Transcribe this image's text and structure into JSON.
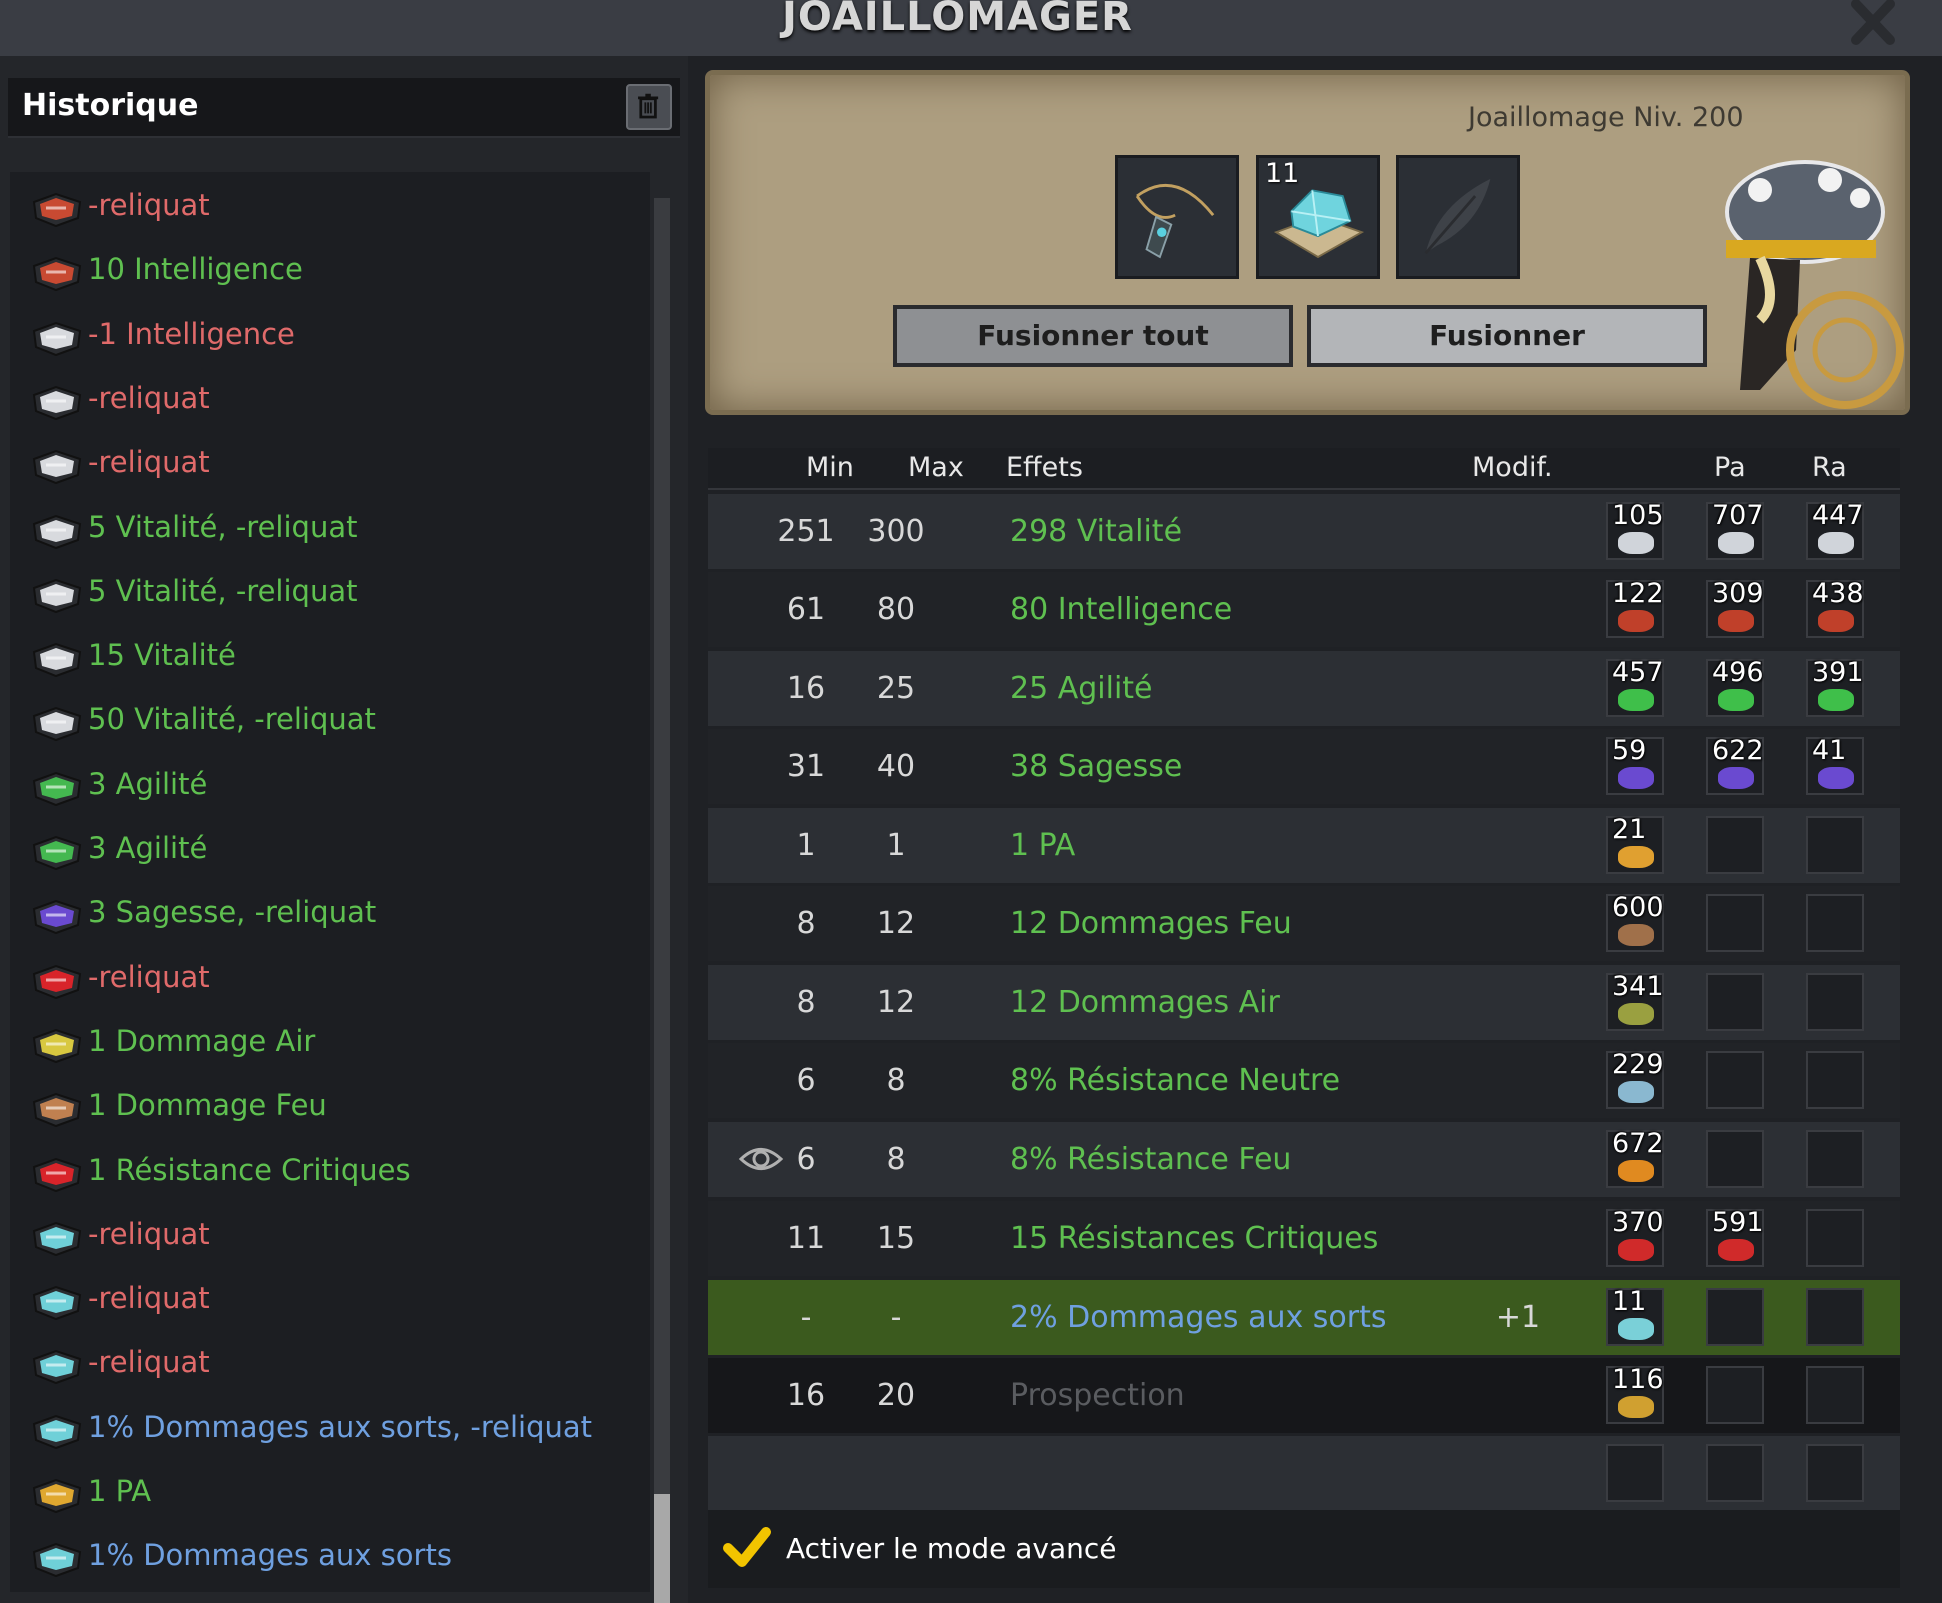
{
  "window": {
    "title": "JOAILLOMAGER"
  },
  "history": {
    "title": "Historique",
    "items": [
      {
        "label": "-reliquat",
        "tone": "red",
        "icon": "red-rune-icon"
      },
      {
        "label": "10 Intelligence",
        "tone": "green",
        "icon": "red-rune-icon"
      },
      {
        "label": "-1 Intelligence",
        "tone": "red",
        "icon": "white-rune-icon"
      },
      {
        "label": "-reliquat",
        "tone": "red",
        "icon": "white-rune-icon"
      },
      {
        "label": "-reliquat",
        "tone": "red",
        "icon": "white-rune-icon"
      },
      {
        "label": "5 Vitalité, -reliquat",
        "tone": "green",
        "icon": "white-rune-icon"
      },
      {
        "label": "5 Vitalité, -reliquat",
        "tone": "green",
        "icon": "white-rune-icon"
      },
      {
        "label": "15 Vitalité",
        "tone": "green",
        "icon": "white-rune-icon"
      },
      {
        "label": "50 Vitalité, -reliquat",
        "tone": "green",
        "icon": "white-rune-icon"
      },
      {
        "label": "3 Agilité",
        "tone": "green",
        "icon": "green-rune-icon"
      },
      {
        "label": "3 Agilité",
        "tone": "green",
        "icon": "green-rune-icon"
      },
      {
        "label": "3 Sagesse, -reliquat",
        "tone": "green",
        "icon": "purple-rune-icon"
      },
      {
        "label": "-reliquat",
        "tone": "red",
        "icon": "red-crystal-icon"
      },
      {
        "label": "1 Dommage Air",
        "tone": "green",
        "icon": "air-rune-icon"
      },
      {
        "label": "1 Dommage Feu",
        "tone": "green",
        "icon": "fire-rune-icon"
      },
      {
        "label": "1 Résistance Critiques",
        "tone": "green",
        "icon": "red-crystal-icon"
      },
      {
        "label": "-reliquat",
        "tone": "red",
        "icon": "cyan-crystal-icon"
      },
      {
        "label": "-reliquat",
        "tone": "red",
        "icon": "cyan-crystal-icon"
      },
      {
        "label": "-reliquat",
        "tone": "red",
        "icon": "cyan-crystal-icon"
      },
      {
        "label": "1% Dommages aux sorts, -reliquat",
        "tone": "blue",
        "icon": "cyan-crystal-icon"
      },
      {
        "label": "1 PA",
        "tone": "green",
        "icon": "gold-rune-icon"
      },
      {
        "label": "1% Dommages aux sorts",
        "tone": "blue",
        "icon": "cyan-crystal-icon"
      }
    ]
  },
  "workshop": {
    "profession_level": "Joaillomage Niv. 200",
    "rune_count": "11",
    "fuse_all_label": "Fusionner tout",
    "fuse_label": "Fusionner"
  },
  "table": {
    "headers": {
      "min": "Min",
      "max": "Max",
      "effects": "Effets",
      "modif": "Modif.",
      "pa": "Pa",
      "ra": "Ra"
    },
    "rows": [
      {
        "min": "251",
        "max": "300",
        "effect": "298 Vitalité",
        "modif": "",
        "runes": [
          "105",
          "707",
          "447"
        ],
        "gem": "#d0d4da"
      },
      {
        "min": "61",
        "max": "80",
        "effect": "80 Intelligence",
        "modif": "",
        "runes": [
          "122",
          "309",
          "438"
        ],
        "gem": "#c0402a"
      },
      {
        "min": "16",
        "max": "25",
        "effect": "25 Agilité",
        "modif": "",
        "runes": [
          "457",
          "496",
          "391"
        ],
        "gem": "#3fbf4a"
      },
      {
        "min": "31",
        "max": "40",
        "effect": "38 Sagesse",
        "modif": "",
        "runes": [
          "59",
          "622",
          "41"
        ],
        "gem": "#6a4ad0"
      },
      {
        "min": "1",
        "max": "1",
        "effect": "1 PA",
        "modif": "",
        "runes": [
          "21",
          "",
          ""
        ],
        "gem": "#e0a030"
      },
      {
        "min": "8",
        "max": "12",
        "effect": "12 Dommages Feu",
        "modif": "",
        "runes": [
          "600",
          "",
          ""
        ],
        "gem": "#a0704a"
      },
      {
        "min": "8",
        "max": "12",
        "effect": "12 Dommages Air",
        "modif": "",
        "runes": [
          "341",
          "",
          ""
        ],
        "gem": "#9aa040"
      },
      {
        "min": "6",
        "max": "8",
        "effect": "8% Résistance Neutre",
        "modif": "",
        "runes": [
          "229",
          "",
          ""
        ],
        "gem": "#8ab8d0"
      },
      {
        "min": "6",
        "max": "8",
        "effect": "8% Résistance Feu",
        "modif": "",
        "runes": [
          "672",
          "",
          ""
        ],
        "gem": "#e08a20"
      },
      {
        "min": "11",
        "max": "15",
        "effect": "15 Résistances Critiques",
        "modif": "",
        "runes": [
          "370",
          "591",
          ""
        ],
        "gem": "#d02a2a"
      },
      {
        "min": "-",
        "max": "-",
        "effect": "2% Dommages aux sorts",
        "modif": "+1",
        "runes": [
          "11",
          "",
          ""
        ],
        "gem": "#7ad0d8"
      },
      {
        "min": "16",
        "max": "20",
        "effect": "Prospection",
        "modif": "",
        "runes": [
          "116",
          "",
          ""
        ],
        "gem": "#d0a030"
      },
      {
        "min": "",
        "max": "",
        "effect": "",
        "modif": "",
        "runes": [
          "",
          "",
          ""
        ],
        "gem": ""
      }
    ]
  },
  "advanced_mode": {
    "label": "Activer le mode avancé",
    "checked": true
  },
  "colors": {
    "effect_green": "#5fc050",
    "effect_blue": "#6fa0e0",
    "removed_red": "#e06a6a",
    "selected_row": "#3b5a1e"
  }
}
